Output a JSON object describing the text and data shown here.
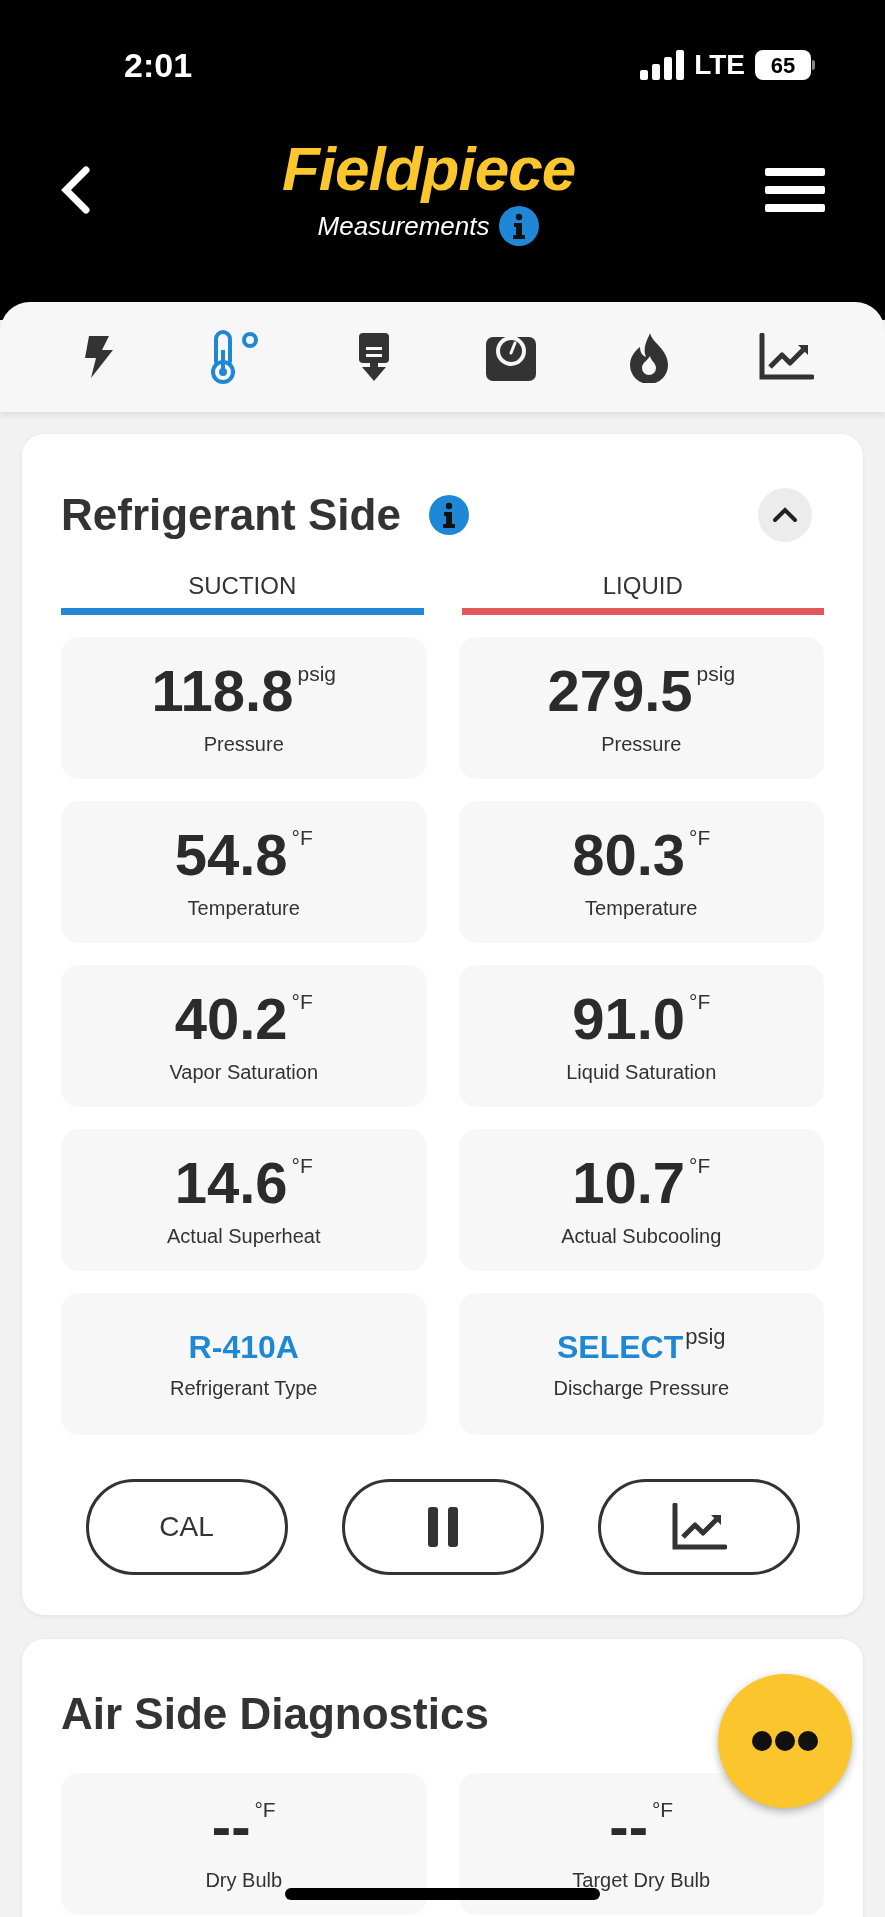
{
  "status_bar": {
    "time": "2:01",
    "network": "LTE",
    "battery": "65"
  },
  "header": {
    "logo": "Fieldpiece",
    "subtitle": "Measurements"
  },
  "tabs": [
    {
      "kind": "bolt",
      "selected": false
    },
    {
      "kind": "thermometer",
      "selected": true
    },
    {
      "kind": "probe",
      "selected": false
    },
    {
      "kind": "scale",
      "selected": false
    },
    {
      "kind": "flame",
      "selected": false
    },
    {
      "kind": "chart",
      "selected": false
    }
  ],
  "refrigerant_card": {
    "title": "Refrigerant Side",
    "expanded": true,
    "columns": [
      {
        "label": "SUCTION",
        "color": "#2388d8"
      },
      {
        "label": "LIQUID",
        "color": "#e0585a"
      }
    ],
    "tiles": [
      {
        "kind": "reading",
        "value": "118.8",
        "unit": "psig",
        "label": "Pressure"
      },
      {
        "kind": "reading",
        "value": "279.5",
        "unit": "psig",
        "label": "Pressure"
      },
      {
        "kind": "reading",
        "value": "54.8",
        "unit": "°F",
        "label": "Temperature"
      },
      {
        "kind": "reading",
        "value": "80.3",
        "unit": "°F",
        "label": "Temperature"
      },
      {
        "kind": "reading",
        "value": "40.2",
        "unit": "°F",
        "label": "Vapor Saturation"
      },
      {
        "kind": "reading",
        "value": "91.0",
        "unit": "°F",
        "label": "Liquid Saturation"
      },
      {
        "kind": "reading",
        "value": "14.6",
        "unit": "°F",
        "label": "Actual Superheat"
      },
      {
        "kind": "reading",
        "value": "10.7",
        "unit": "°F",
        "label": "Actual Subcooling"
      },
      {
        "kind": "selector",
        "value": "R-410A",
        "label": "Refrigerant Type"
      },
      {
        "kind": "selector",
        "value": "SELECT",
        "unit": "psig",
        "label": "Discharge Pressure"
      }
    ],
    "buttons": [
      {
        "kind": "text",
        "label": "CAL"
      },
      {
        "kind": "pause"
      },
      {
        "kind": "chart"
      }
    ]
  },
  "air_card": {
    "title": "Air Side Diagnostics",
    "tiles": [
      {
        "kind": "reading",
        "value": "--",
        "unit": "°F",
        "label": "Dry Bulb"
      },
      {
        "kind": "reading",
        "value": "--",
        "unit": "°F",
        "label": "Target Dry Bulb"
      }
    ]
  }
}
